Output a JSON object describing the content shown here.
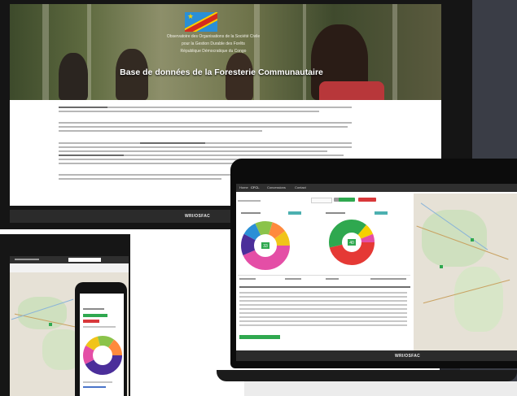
{
  "website": {
    "hero_title": "Base de données de la Foresterie Communautaire",
    "hero_subtitles": [
      "Observatoire des Organisations de la Société Civile",
      "pour la Gestion Durable des Forêts",
      "République Démocratique du Congo"
    ],
    "footer_logo": "WRI/OSFAC"
  },
  "laptop_app": {
    "header_tabs": [
      "Home",
      "CFCL",
      "Concessions",
      "Contact"
    ],
    "footer_logo": "WRI/OSFAC",
    "chart_percent_labels": [
      "33",
      "40"
    ]
  },
  "colors": {
    "flag_blue": "#2a8fd6",
    "flag_red": "#d52b1e",
    "flag_yellow": "#f6d000",
    "accent_green": "#2fa84f",
    "accent_red": "#d8383a",
    "teal": "#4cb0b0"
  }
}
